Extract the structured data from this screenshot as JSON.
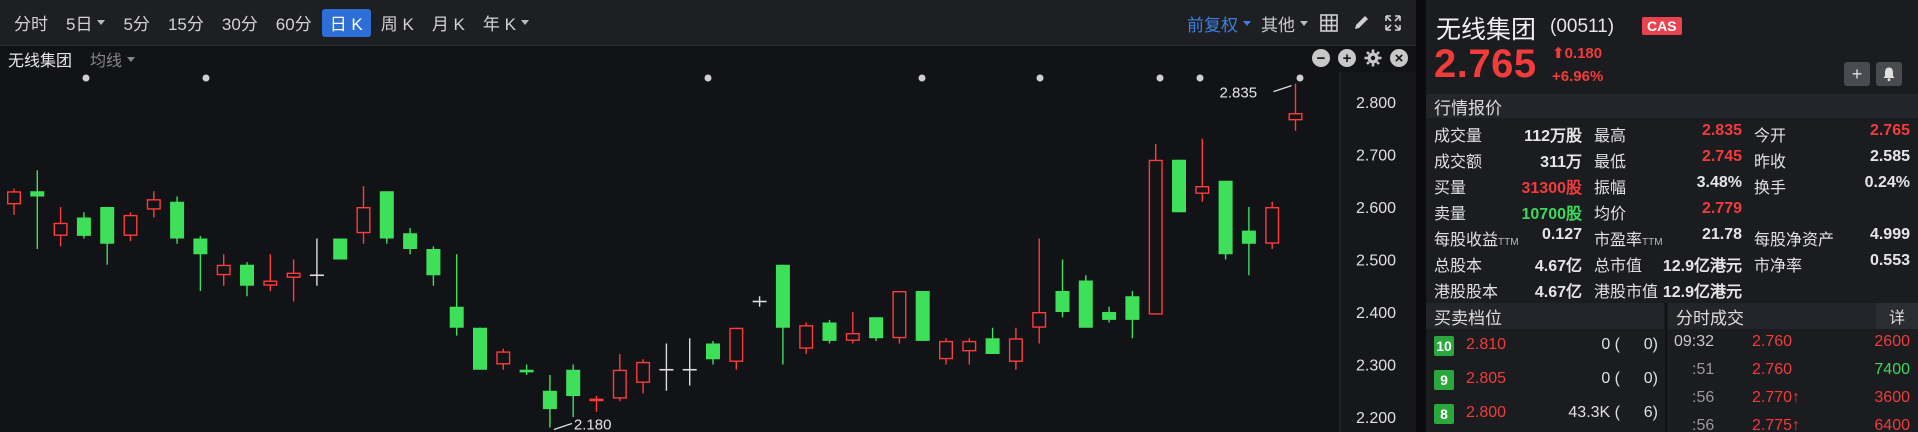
{
  "toolbar": {
    "timeframes": [
      {
        "label": "分时",
        "dropdown": false
      },
      {
        "label": "5日",
        "dropdown": true
      },
      {
        "label": "5分",
        "dropdown": false
      },
      {
        "label": "15分",
        "dropdown": false
      },
      {
        "label": "30分",
        "dropdown": false
      },
      {
        "label": "60分",
        "dropdown": false
      },
      {
        "label": "日 K",
        "dropdown": false,
        "active": true
      },
      {
        "label": "周 K",
        "dropdown": false
      },
      {
        "label": "月 K",
        "dropdown": false
      },
      {
        "label": "年 K",
        "dropdown": true
      }
    ],
    "adjust_label": "前复权",
    "other_label": "其他",
    "icons": [
      "layout-grid-icon",
      "pen-icon",
      "expand-icon"
    ]
  },
  "subbar": {
    "stock_name": "无线集团",
    "indicator_label": "均线",
    "icons": [
      "minus-circle-icon",
      "plus-circle-icon",
      "gear-icon",
      "close-circle-icon"
    ]
  },
  "chart_data": {
    "type": "candlestick",
    "y_ticks": [
      "2.800",
      "2.700",
      "2.600",
      "2.500",
      "2.400",
      "2.300",
      "2.200"
    ],
    "ylim": [
      2.18,
      2.835
    ],
    "annotations": [
      {
        "label": "2.835",
        "kind": "high"
      },
      {
        "label": "2.180",
        "kind": "low"
      }
    ],
    "up_color": "#ff3b3b",
    "down_color": "#3ee05a",
    "neutral_color": "#dddddd",
    "candles": [
      {
        "o": 2.605,
        "h": 2.635,
        "l": 2.585,
        "c": 2.63
      },
      {
        "o": 2.63,
        "h": 2.67,
        "l": 2.52,
        "c": 2.62
      },
      {
        "o": 2.545,
        "h": 2.6,
        "l": 2.525,
        "c": 2.57
      },
      {
        "o": 2.58,
        "h": 2.59,
        "l": 2.54,
        "c": 2.545
      },
      {
        "o": 2.6,
        "h": 2.6,
        "l": 2.49,
        "c": 2.53
      },
      {
        "o": 2.545,
        "h": 2.59,
        "l": 2.535,
        "c": 2.585
      },
      {
        "o": 2.595,
        "h": 2.63,
        "l": 2.58,
        "c": 2.615
      },
      {
        "o": 2.61,
        "h": 2.62,
        "l": 2.53,
        "c": 2.54
      },
      {
        "o": 2.54,
        "h": 2.545,
        "l": 2.44,
        "c": 2.51
      },
      {
        "o": 2.47,
        "h": 2.51,
        "l": 2.45,
        "c": 2.49
      },
      {
        "o": 2.49,
        "h": 2.495,
        "l": 2.43,
        "c": 2.45
      },
      {
        "o": 2.45,
        "h": 2.51,
        "l": 2.44,
        "c": 2.46
      },
      {
        "o": 2.465,
        "h": 2.5,
        "l": 2.42,
        "c": 2.475
      },
      {
        "o": 2.47,
        "h": 2.54,
        "l": 2.45,
        "c": 2.47
      },
      {
        "o": 2.54,
        "h": 2.54,
        "l": 2.5,
        "c": 2.5
      },
      {
        "o": 2.55,
        "h": 2.64,
        "l": 2.53,
        "c": 2.6
      },
      {
        "o": 2.63,
        "h": 2.63,
        "l": 2.53,
        "c": 2.54
      },
      {
        "o": 2.55,
        "h": 2.56,
        "l": 2.51,
        "c": 2.52
      },
      {
        "o": 2.52,
        "h": 2.525,
        "l": 2.45,
        "c": 2.47
      },
      {
        "o": 2.41,
        "h": 2.51,
        "l": 2.355,
        "c": 2.37
      },
      {
        "o": 2.37,
        "h": 2.37,
        "l": 2.29,
        "c": 2.29
      },
      {
        "o": 2.3,
        "h": 2.33,
        "l": 2.29,
        "c": 2.325
      },
      {
        "o": 2.29,
        "h": 2.3,
        "l": 2.28,
        "c": 2.285
      },
      {
        "o": 2.25,
        "h": 2.28,
        "l": 2.18,
        "c": 2.215
      },
      {
        "o": 2.29,
        "h": 2.3,
        "l": 2.2,
        "c": 2.24
      },
      {
        "o": 2.23,
        "h": 2.24,
        "l": 2.21,
        "c": 2.235
      },
      {
        "o": 2.235,
        "h": 2.32,
        "l": 2.23,
        "c": 2.29
      },
      {
        "o": 2.265,
        "h": 2.31,
        "l": 2.245,
        "c": 2.305
      },
      {
        "o": 2.29,
        "h": 2.34,
        "l": 2.25,
        "c": 2.29
      },
      {
        "o": 2.29,
        "h": 2.35,
        "l": 2.26,
        "c": 2.29
      },
      {
        "o": 2.34,
        "h": 2.345,
        "l": 2.3,
        "c": 2.31
      },
      {
        "o": 2.305,
        "h": 2.37,
        "l": 2.29,
        "c": 2.37
      },
      {
        "o": 2.42,
        "h": 2.43,
        "l": 2.41,
        "c": 2.42
      },
      {
        "o": 2.49,
        "h": 2.49,
        "l": 2.3,
        "c": 2.37
      },
      {
        "o": 2.33,
        "h": 2.38,
        "l": 2.32,
        "c": 2.375
      },
      {
        "o": 2.38,
        "h": 2.385,
        "l": 2.34,
        "c": 2.345
      },
      {
        "o": 2.345,
        "h": 2.4,
        "l": 2.34,
        "c": 2.36
      },
      {
        "o": 2.39,
        "h": 2.39,
        "l": 2.345,
        "c": 2.35
      },
      {
        "o": 2.35,
        "h": 2.44,
        "l": 2.34,
        "c": 2.44
      },
      {
        "o": 2.44,
        "h": 2.44,
        "l": 2.345,
        "c": 2.345
      },
      {
        "o": 2.31,
        "h": 2.35,
        "l": 2.3,
        "c": 2.345
      },
      {
        "o": 2.325,
        "h": 2.35,
        "l": 2.3,
        "c": 2.345
      },
      {
        "o": 2.35,
        "h": 2.37,
        "l": 2.32,
        "c": 2.32
      },
      {
        "o": 2.305,
        "h": 2.37,
        "l": 2.29,
        "c": 2.35
      },
      {
        "o": 2.37,
        "h": 2.54,
        "l": 2.34,
        "c": 2.4
      },
      {
        "o": 2.44,
        "h": 2.5,
        "l": 2.39,
        "c": 2.4
      },
      {
        "o": 2.46,
        "h": 2.47,
        "l": 2.37,
        "c": 2.37
      },
      {
        "o": 2.4,
        "h": 2.41,
        "l": 2.38,
        "c": 2.385
      },
      {
        "o": 2.43,
        "h": 2.44,
        "l": 2.35,
        "c": 2.385
      },
      {
        "o": 2.395,
        "h": 2.72,
        "l": 2.395,
        "c": 2.69
      },
      {
        "o": 2.69,
        "h": 2.69,
        "l": 2.59,
        "c": 2.59
      },
      {
        "o": 2.625,
        "h": 2.73,
        "l": 2.61,
        "c": 2.64
      },
      {
        "o": 2.65,
        "h": 2.65,
        "l": 2.5,
        "c": 2.51
      },
      {
        "o": 2.555,
        "h": 2.6,
        "l": 2.47,
        "c": 2.53
      },
      {
        "o": 2.53,
        "h": 2.61,
        "l": 2.52,
        "c": 2.6
      },
      {
        "o": 2.765,
        "h": 2.835,
        "l": 2.745,
        "c": 2.779
      }
    ]
  },
  "quote": {
    "name": "无线集团",
    "code": "(00511)",
    "badge": "CAS",
    "price": "2.765",
    "change": "0.180",
    "change_pct": "+6.96%",
    "market_section": "行情报价",
    "grid1": [
      [
        {
          "label": "成交量",
          "value": "112万股"
        },
        {
          "label": "最高",
          "value": "2.835",
          "color": "red"
        },
        {
          "label": "今开",
          "value": "2.765",
          "color": "red"
        }
      ],
      [
        {
          "label": "成交额",
          "value": "311万"
        },
        {
          "label": "最低",
          "value": "2.745",
          "color": "red"
        },
        {
          "label": "昨收",
          "value": "2.585"
        }
      ],
      [
        {
          "label": "买量",
          "value": "31300股",
          "color": "red"
        },
        {
          "label": "振幅",
          "value": "3.48%"
        },
        {
          "label": "换手",
          "value": "0.24%"
        }
      ],
      [
        {
          "label": "卖量",
          "value": "10700股",
          "color": "green"
        },
        {
          "label": "均价",
          "value": "2.779",
          "color": "red"
        }
      ]
    ],
    "grid2": [
      [
        {
          "label": "每股收益",
          "ttm": "TTM",
          "value": "0.127"
        },
        {
          "label": "市盈率",
          "ttm": "TTM",
          "value": "21.78"
        },
        {
          "label": "每股净资产",
          "value": "4.999"
        }
      ],
      [
        {
          "label": "总股本",
          "value": "4.67亿"
        },
        {
          "label": "总市值",
          "value": "12.9亿港元"
        },
        {
          "label": "市净率",
          "value": "0.553"
        }
      ],
      [
        {
          "label": "港股股本",
          "value": "4.67亿"
        },
        {
          "label": "港股市值",
          "value": "12.9亿港元"
        }
      ]
    ]
  },
  "orderbook": {
    "title": "买卖档位",
    "rows": [
      {
        "level": "10",
        "price": "2.810",
        "volume": "0 (",
        "count": "0)"
      },
      {
        "level": "9",
        "price": "2.805",
        "volume": "0 (",
        "count": "0)"
      },
      {
        "level": "8",
        "price": "2.800",
        "volume": "43.3K (",
        "count": "6)"
      }
    ]
  },
  "ticks": {
    "title": "分时成交",
    "detail_label": "详",
    "rows": [
      {
        "time": "09:32",
        "price": "2.760",
        "volume": "2600",
        "vol_color": "red",
        "arrow": ""
      },
      {
        "time": ":51",
        "price": "2.760",
        "volume": "7400",
        "vol_color": "green",
        "arrow": ""
      },
      {
        "time": ":56",
        "price": "2.770",
        "volume": "3600",
        "vol_color": "red",
        "arrow": "↑"
      },
      {
        "time": ":56",
        "price": "2.775",
        "volume": "6400",
        "vol_color": "red",
        "arrow": "↑"
      }
    ]
  }
}
